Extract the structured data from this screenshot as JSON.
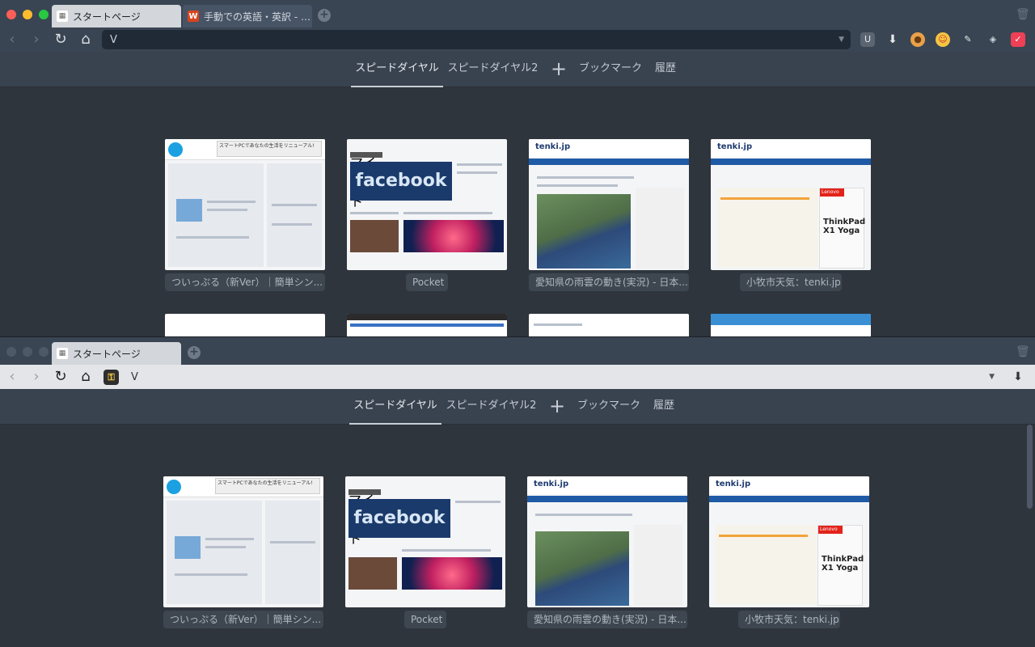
{
  "windows": [
    {
      "tabs": [
        {
          "label": "スタートページ",
          "icon": "grid-icon"
        },
        {
          "label": "手動での英語・英訳 - 英和",
          "icon": "w-icon"
        }
      ],
      "address": {
        "value": "V"
      },
      "extensions": [
        "ublock-icon",
        "download-icon",
        "cookie-icon",
        "emoji-icon",
        "broom-icon",
        "ghost-icon",
        "pocket-icon"
      ]
    },
    {
      "tabs": [
        {
          "label": "スタートページ",
          "icon": "grid-icon"
        }
      ],
      "address": {
        "value": "V"
      },
      "extensions": [
        "download-icon"
      ]
    }
  ],
  "speed_dial_nav": {
    "tabs": [
      "スピードダイヤル",
      "スピードダイヤル2",
      "ブックマーク",
      "履歴"
    ],
    "active": "スピードダイヤル"
  },
  "speed_dials": [
    {
      "label": "ついっぷる（新Ver）｜簡単シン...",
      "thumb": "twipple"
    },
    {
      "label": "Pocket",
      "thumb": "pocket"
    },
    {
      "label": "愛知県の雨雲の動き(実況) - 日本...",
      "thumb": "tenki-rain"
    },
    {
      "label": "小牧市天気：tenki.jp",
      "thumb": "tenki-komaki"
    }
  ],
  "thumb_text": {
    "twipple_banner": "スマートPCであなたの生活をリニューアル!",
    "pocket_header": "マイリスト",
    "pocket_caption": "facebook",
    "tenki_logo": "tenki.jp",
    "lenovo_brand": "Lenovo",
    "lenovo_model": "ThinkPad X1 Yoga"
  }
}
